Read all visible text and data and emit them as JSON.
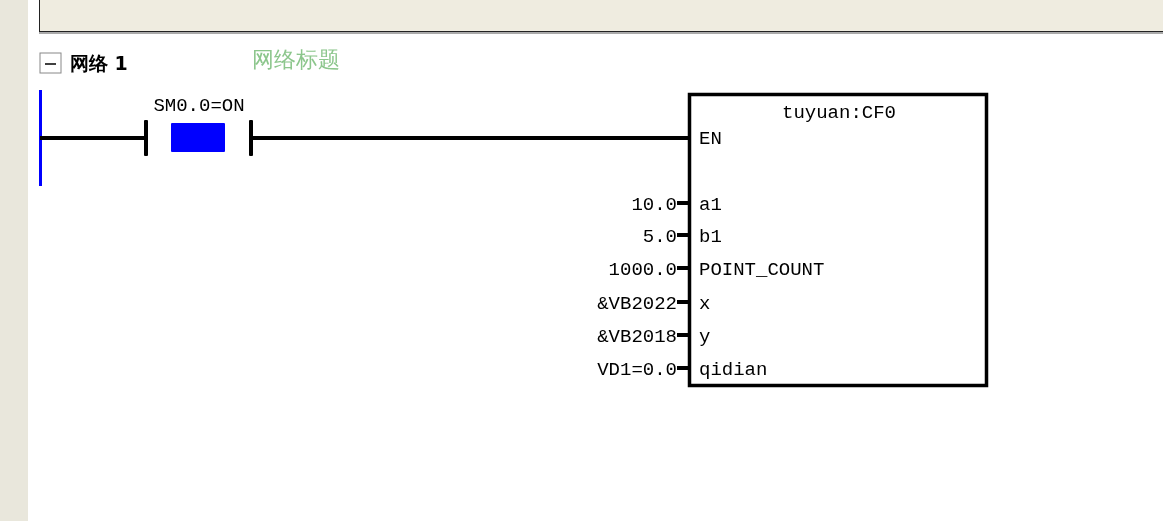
{
  "network": {
    "label": "网络 1",
    "title": "网络标题",
    "expanded": true
  },
  "rung": {
    "contact": {
      "label": "SM0.0=ON",
      "energized": true
    },
    "block": {
      "title": "tuyuan:CF0",
      "enable": "EN",
      "inputs": [
        {
          "value": "10.0",
          "pin": "a1"
        },
        {
          "value": "5.0",
          "pin": "b1"
        },
        {
          "value": "1000.0",
          "pin": "POINT_COUNT"
        },
        {
          "value": "&VB2022",
          "pin": "x"
        },
        {
          "value": "&VB2018",
          "pin": "y"
        },
        {
          "value": "VD1=0.0",
          "pin": "qidian"
        }
      ]
    }
  }
}
